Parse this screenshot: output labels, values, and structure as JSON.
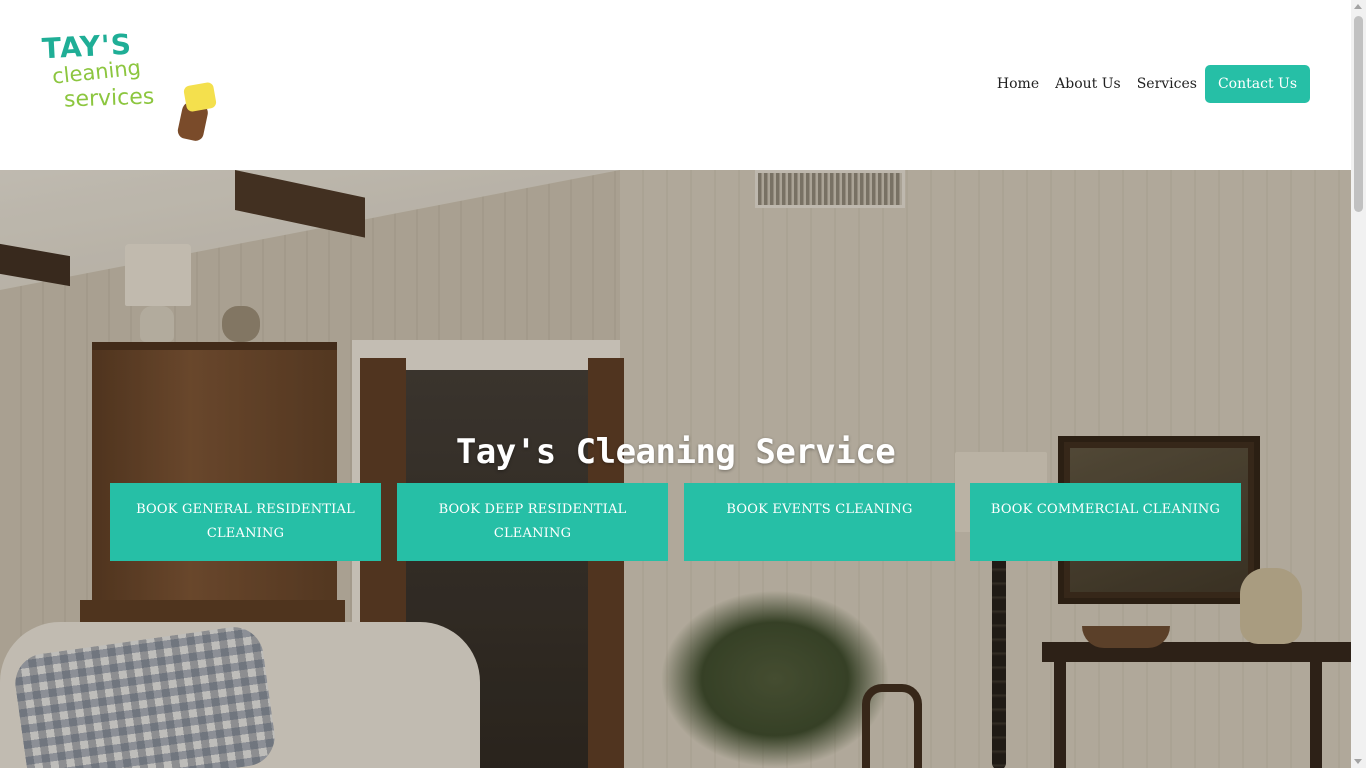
{
  "logo": {
    "line1": "TAY'S",
    "line2": "cleaning",
    "line3": "services"
  },
  "nav": {
    "home": "Home",
    "about": "About Us",
    "services": "Services",
    "contact": "Contact Us"
  },
  "hero": {
    "title": "Tay's Cleaning Service",
    "buttons": [
      "BOOK GENERAL RESIDENTIAL CLEANING",
      "BOOK DEEP RESIDENTIAL CLEANING",
      "BOOK EVENTS CLEANING",
      "BOOK COMMERCIAL CLEANING"
    ]
  },
  "colors": {
    "accent": "#26bfa6",
    "logo_teal": "#1fae96",
    "logo_green": "#8cc63f",
    "nav_text": "#222222"
  },
  "icons": {
    "logo_image": "sponge-hand-icon"
  }
}
